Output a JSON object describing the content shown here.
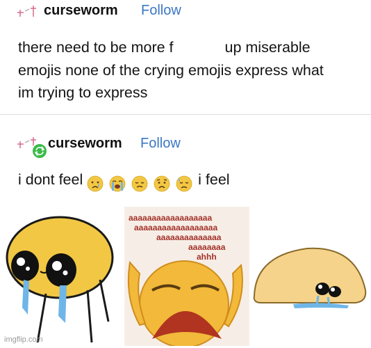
{
  "post1": {
    "username": "curseworm",
    "follow_label": "Follow",
    "lines": [
      "there need to be more f",
      "up miserable",
      "emojis none of the crying emojis express what",
      "im trying to express"
    ]
  },
  "post2": {
    "username": "curseworm",
    "follow_label": "Follow",
    "text_before": "i dont feel",
    "text_after": "i feel",
    "emojis": [
      "crying-face",
      "loudly-crying-face",
      "disappointed-face",
      "worried-face",
      "sad-sweat-face"
    ],
    "middle_image_text": [
      "aaaaaaaaaaaaaaaaaa",
      "aaaaaaaaaaaaaaaaaa",
      "aaaaaaaaaaaaaa",
      "aaaaaaaa",
      "ahhh"
    ]
  },
  "watermark": "imgflip.com",
  "colors": {
    "follow": "#3b77c5",
    "emoji_yellow": "#f2c744",
    "tear_blue": "#6fb6e8",
    "reblog_green": "#3cbb4a",
    "scream_text": "#a3322a"
  }
}
